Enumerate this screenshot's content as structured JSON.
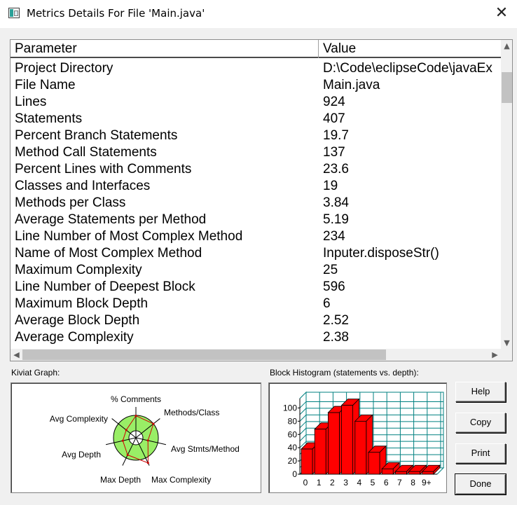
{
  "window": {
    "title": "Metrics Details For File 'Main.java'",
    "close_glyph": "✕"
  },
  "table": {
    "headers": {
      "parameter": "Parameter",
      "value": "Value"
    },
    "rows": [
      {
        "p": "Project Directory",
        "v": "D:\\Code\\eclipseCode\\javaEx"
      },
      {
        "p": "File Name",
        "v": "Main.java"
      },
      {
        "p": "Lines",
        "v": "924"
      },
      {
        "p": "Statements",
        "v": "407"
      },
      {
        "p": "Percent Branch Statements",
        "v": "19.7"
      },
      {
        "p": "Method Call Statements",
        "v": "137"
      },
      {
        "p": "Percent Lines with Comments",
        "v": "23.6"
      },
      {
        "p": "Classes and Interfaces",
        "v": "19"
      },
      {
        "p": "Methods per Class",
        "v": "3.84"
      },
      {
        "p": "Average Statements per Method",
        "v": "5.19"
      },
      {
        "p": "Line Number of Most Complex Method",
        "v": "234"
      },
      {
        "p": "Name of Most Complex Method",
        "v": "Inputer.disposeStr()"
      },
      {
        "p": "Maximum Complexity",
        "v": "25"
      },
      {
        "p": "Line Number of Deepest Block",
        "v": "596"
      },
      {
        "p": "Maximum Block Depth",
        "v": "6"
      },
      {
        "p": "Average Block Depth",
        "v": "2.52"
      },
      {
        "p": "Average Complexity",
        "v": "2.38"
      }
    ]
  },
  "kiviat": {
    "label": "Kiviat Graph:",
    "axes": [
      {
        "name": "% Comments"
      },
      {
        "name": "Methods/Class"
      },
      {
        "name": "Avg Stmts/Method"
      },
      {
        "name": "Max Complexity"
      },
      {
        "name": "Max Depth"
      },
      {
        "name": "Avg Depth"
      },
      {
        "name": "Avg Complexity"
      }
    ],
    "values": [
      0.98,
      1.0,
      0.55,
      1.25,
      0.85,
      0.6,
      0.55
    ],
    "colors": {
      "band": "#99ee66",
      "line": "#cc0000",
      "axis": "#000000"
    }
  },
  "histogram": {
    "label": "Block Histogram (statements vs. depth):",
    "chart_data": {
      "type": "bar",
      "categories": [
        "0",
        "1",
        "2",
        "3",
        "4",
        "5",
        "6",
        "7",
        "8",
        "9+"
      ],
      "values": [
        38,
        68,
        93,
        104,
        80,
        33,
        8,
        4,
        4,
        4
      ],
      "yticks": [
        "0",
        "20",
        "40",
        "60",
        "80",
        "100"
      ],
      "ylim": [
        0,
        110
      ],
      "bar_color": "#ff0000",
      "grid_color": "#008080"
    }
  },
  "buttons": {
    "help": "Help",
    "copy": "Copy",
    "print": "Print",
    "done": "Done"
  }
}
